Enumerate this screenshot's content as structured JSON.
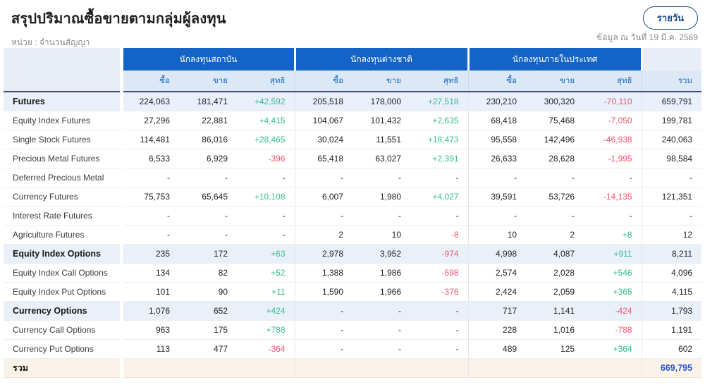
{
  "page": {
    "title": "สรุปปริมาณซื้อขายตามกลุ่มผู้ลงทุน",
    "unit_label": "หน่วย : จำนวนสัญญา",
    "as_of_label": "ข้อมูล ณ วันที่ 19 มี.ค. 2569",
    "period_button_label": "รายวัน"
  },
  "colors": {
    "header_blue": "#1463C6",
    "subheader_bg": "#dde8f6",
    "subheader_text": "#1565c0",
    "section_row_bg": "#e9f0fa",
    "footer_row_bg": "#fbf3e9",
    "positive": "#34BE8E",
    "negative": "#EF566F",
    "grand_total_blue": "#2E55D4",
    "button_blue": "#17498e"
  },
  "table": {
    "groups": [
      {
        "label": "นักลงทุนสถาบัน"
      },
      {
        "label": "นักลงทุนต่างชาติ"
      },
      {
        "label": "นักลงทุนภายในประเทศ"
      }
    ],
    "sub_headers": [
      "ซื้อ",
      "ขาย",
      "สุทธิ"
    ],
    "total_header": "รวม",
    "rows": [
      {
        "label": "Futures",
        "style": "section",
        "cells": [
          "224,063",
          "181,471",
          "+42,592",
          "205,518",
          "178,000",
          "+27,518",
          "230,210",
          "300,320",
          "-70,110",
          "659,791"
        ]
      },
      {
        "label": "Equity Index Futures",
        "style": "",
        "cells": [
          "27,296",
          "22,881",
          "+4,415",
          "104,067",
          "101,432",
          "+2,635",
          "68,418",
          "75,468",
          "-7,050",
          "199,781"
        ]
      },
      {
        "label": "Single Stock Futures",
        "style": "",
        "cells": [
          "114,481",
          "86,016",
          "+28,465",
          "30,024",
          "11,551",
          "+18,473",
          "95,558",
          "142,496",
          "-46,938",
          "240,063"
        ]
      },
      {
        "label": "Precious Metal Futures",
        "style": "",
        "cells": [
          "6,533",
          "6,929",
          "-396",
          "65,418",
          "63,027",
          "+2,391",
          "26,633",
          "28,628",
          "-1,995",
          "98,584"
        ]
      },
      {
        "label": "Deferred Precious Metal",
        "style": "",
        "cells": [
          "-",
          "-",
          "-",
          "-",
          "-",
          "-",
          "-",
          "-",
          "-",
          "-"
        ]
      },
      {
        "label": "Currency Futures",
        "style": "",
        "cells": [
          "75,753",
          "65,645",
          "+10,108",
          "6,007",
          "1,980",
          "+4,027",
          "39,591",
          "53,726",
          "-14,135",
          "121,351"
        ]
      },
      {
        "label": "Interest Rate Futures",
        "style": "",
        "cells": [
          "-",
          "-",
          "-",
          "-",
          "-",
          "-",
          "-",
          "-",
          "-",
          "-"
        ]
      },
      {
        "label": "Agriculture Futures",
        "style": "",
        "cells": [
          "-",
          "-",
          "-",
          "2",
          "10",
          "-8",
          "10",
          "2",
          "+8",
          "12"
        ]
      },
      {
        "label": "Equity Index Options",
        "style": "section",
        "cells": [
          "235",
          "172",
          "+63",
          "2,978",
          "3,952",
          "-974",
          "4,998",
          "4,087",
          "+911",
          "8,211"
        ]
      },
      {
        "label": "Equity Index Call Options",
        "style": "",
        "cells": [
          "134",
          "82",
          "+52",
          "1,388",
          "1,986",
          "-598",
          "2,574",
          "2,028",
          "+546",
          "4,096"
        ]
      },
      {
        "label": "Equity Index Put Options",
        "style": "",
        "cells": [
          "101",
          "90",
          "+11",
          "1,590",
          "1,966",
          "-376",
          "2,424",
          "2,059",
          "+365",
          "4,115"
        ]
      },
      {
        "label": "Currency Options",
        "style": "section",
        "cells": [
          "1,076",
          "652",
          "+424",
          "-",
          "-",
          "-",
          "717",
          "1,141",
          "-424",
          "1,793"
        ]
      },
      {
        "label": "Currency Call Options",
        "style": "",
        "cells": [
          "963",
          "175",
          "+788",
          "-",
          "-",
          "-",
          "228",
          "1,016",
          "-788",
          "1,191"
        ]
      },
      {
        "label": "Currency Put Options",
        "style": "",
        "cells": [
          "113",
          "477",
          "-364",
          "-",
          "-",
          "-",
          "489",
          "125",
          "+364",
          "602"
        ]
      },
      {
        "label": "รวม",
        "style": "footer",
        "cells": [
          "",
          "",
          "",
          "",
          "",
          "",
          "",
          "",
          "",
          "669,795"
        ]
      }
    ]
  }
}
